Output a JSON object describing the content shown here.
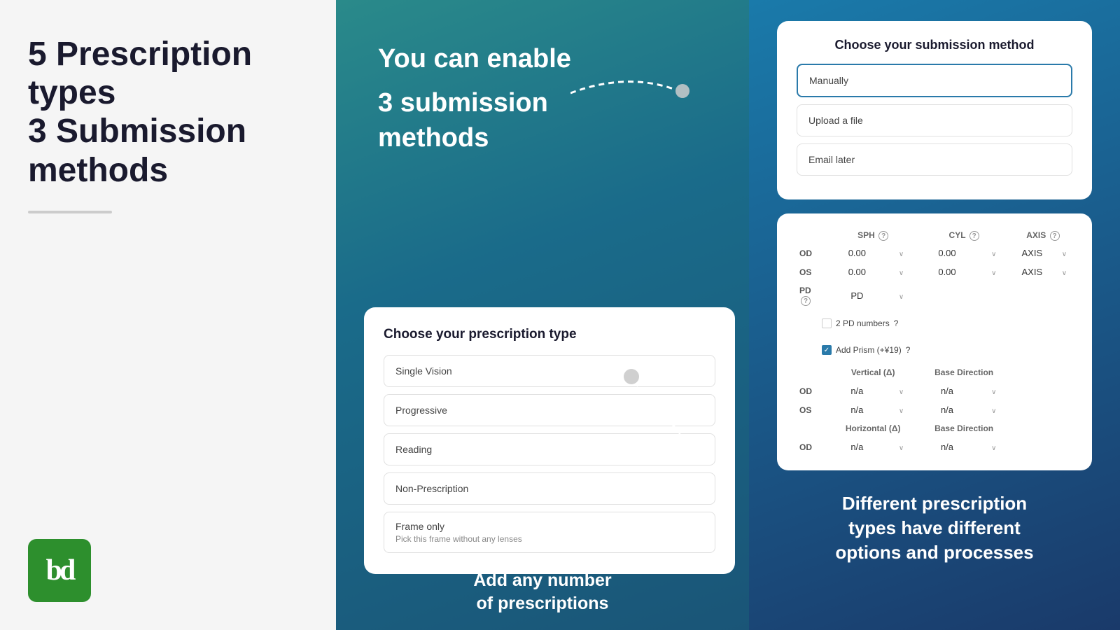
{
  "left": {
    "title_line1": "5 Prescription types",
    "title_line2": "3 Submission",
    "title_line3": "methods",
    "logo_text": "bd"
  },
  "middle": {
    "heading_line1": "You can enable",
    "heading_line2": "3 submission",
    "heading_line3": "methods",
    "prescription_card": {
      "title": "Choose your prescription type",
      "items": [
        {
          "label": "Single Vision",
          "sub": ""
        },
        {
          "label": "Progressive",
          "sub": ""
        },
        {
          "label": "Reading",
          "sub": ""
        },
        {
          "label": "Non-Prescription",
          "sub": ""
        },
        {
          "label": "Frame only",
          "sub": "Pick this frame without any lenses"
        }
      ]
    },
    "add_label_line1": "Add any number",
    "add_label_line2": "of prescriptions"
  },
  "right": {
    "submission_card": {
      "title": "Choose your submission method",
      "items": [
        {
          "label": "Manually",
          "selected": true
        },
        {
          "label": "Upload a file",
          "selected": false
        },
        {
          "label": "Email later",
          "selected": false
        }
      ]
    },
    "table_card": {
      "headers": [
        "",
        "SPH",
        "",
        "CYL",
        "",
        "AXIS",
        ""
      ],
      "rows": [
        {
          "label": "OD",
          "sph": "0.00",
          "cyl": "0.00",
          "axis": "AXIS"
        },
        {
          "label": "OS",
          "sph": "0.00",
          "cyl": "0.00",
          "axis": "AXIS"
        }
      ],
      "pd_label": "PD",
      "pd_row_label": "PD",
      "two_pd_label": "2 PD numbers",
      "add_prism_label": "Add Prism (+¥19)",
      "vertical_label": "Vertical (Δ)",
      "base_dir_label": "Base Direction",
      "horizontal_label": "Horizontal (Δ)",
      "prism_rows_od": {
        "label": "OD",
        "v": "n/a",
        "bd1": "n/a"
      },
      "prism_rows_os": {
        "label": "OS",
        "v": "n/a",
        "bd2": "n/a"
      },
      "h_row_od": {
        "label": "OD",
        "h": "n/a",
        "bd": "n/a"
      }
    },
    "bottom_text_line1": "Different prescription",
    "bottom_text_line2": "types have different",
    "bottom_text_line3": "options and processes"
  }
}
